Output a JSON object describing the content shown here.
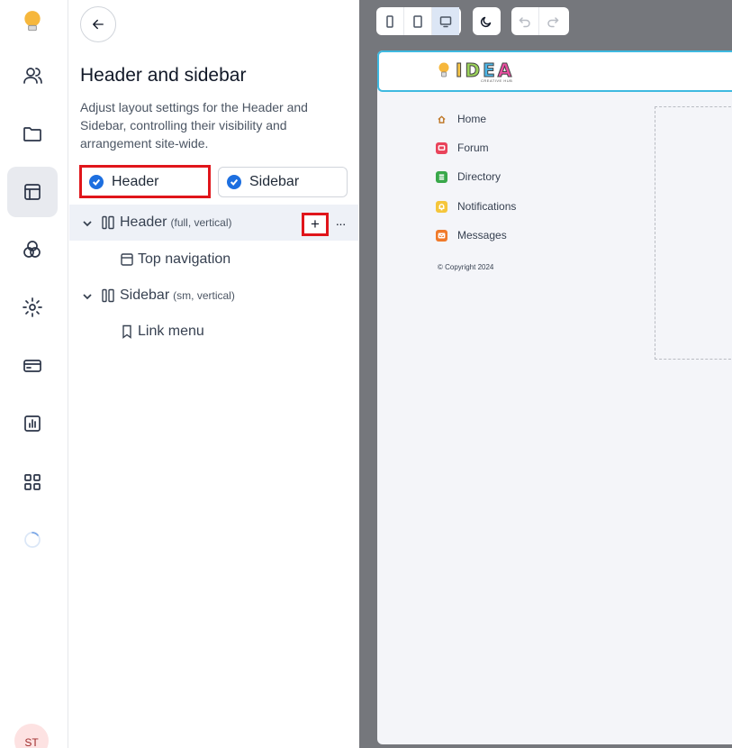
{
  "rail": {
    "avatar_initials": "ST"
  },
  "panel": {
    "title": "Header and sidebar",
    "description": "Adjust layout settings for the Header and Sidebar, controlling their visibility and arrangement site-wide.",
    "header_toggle": {
      "label": "Header",
      "checked": true
    },
    "sidebar_toggle": {
      "label": "Sidebar",
      "checked": true
    },
    "tree": [
      {
        "label": "Header",
        "meta": "(full, vertical)",
        "expanded": true,
        "selected": true,
        "add_label": "+",
        "more_label": "···"
      },
      {
        "label": "Top navigation",
        "child": true
      },
      {
        "label": "Sidebar",
        "meta": "(sm, vertical)",
        "expanded": true
      },
      {
        "label": "Link menu",
        "child": true
      }
    ]
  },
  "preview": {
    "logo": {
      "letters": [
        "I",
        "D",
        "E",
        "A"
      ],
      "letter_colors": [
        "#f6c547",
        "#9bd35a",
        "#4cb6e8",
        "#e94ea0"
      ],
      "subtitle": "CREATIVE HUB"
    },
    "nav": [
      {
        "label": "Home",
        "icon": "home-icon",
        "color": "#ffffff",
        "stroke": "#c07a2c"
      },
      {
        "label": "Forum",
        "icon": "chat-icon",
        "color": "#e9435b"
      },
      {
        "label": "Directory",
        "icon": "list-icon",
        "color": "#39a84a"
      },
      {
        "label": "Notifications",
        "icon": "bell-icon",
        "color": "#f5c63b"
      },
      {
        "label": "Messages",
        "icon": "mail-icon",
        "color": "#f07a2a"
      }
    ],
    "copyright": "© Copyright 2024"
  },
  "colors": {
    "accent": "#1d6fe0",
    "highlight": "#e0151b",
    "preview_border": "#3eb9e0"
  }
}
